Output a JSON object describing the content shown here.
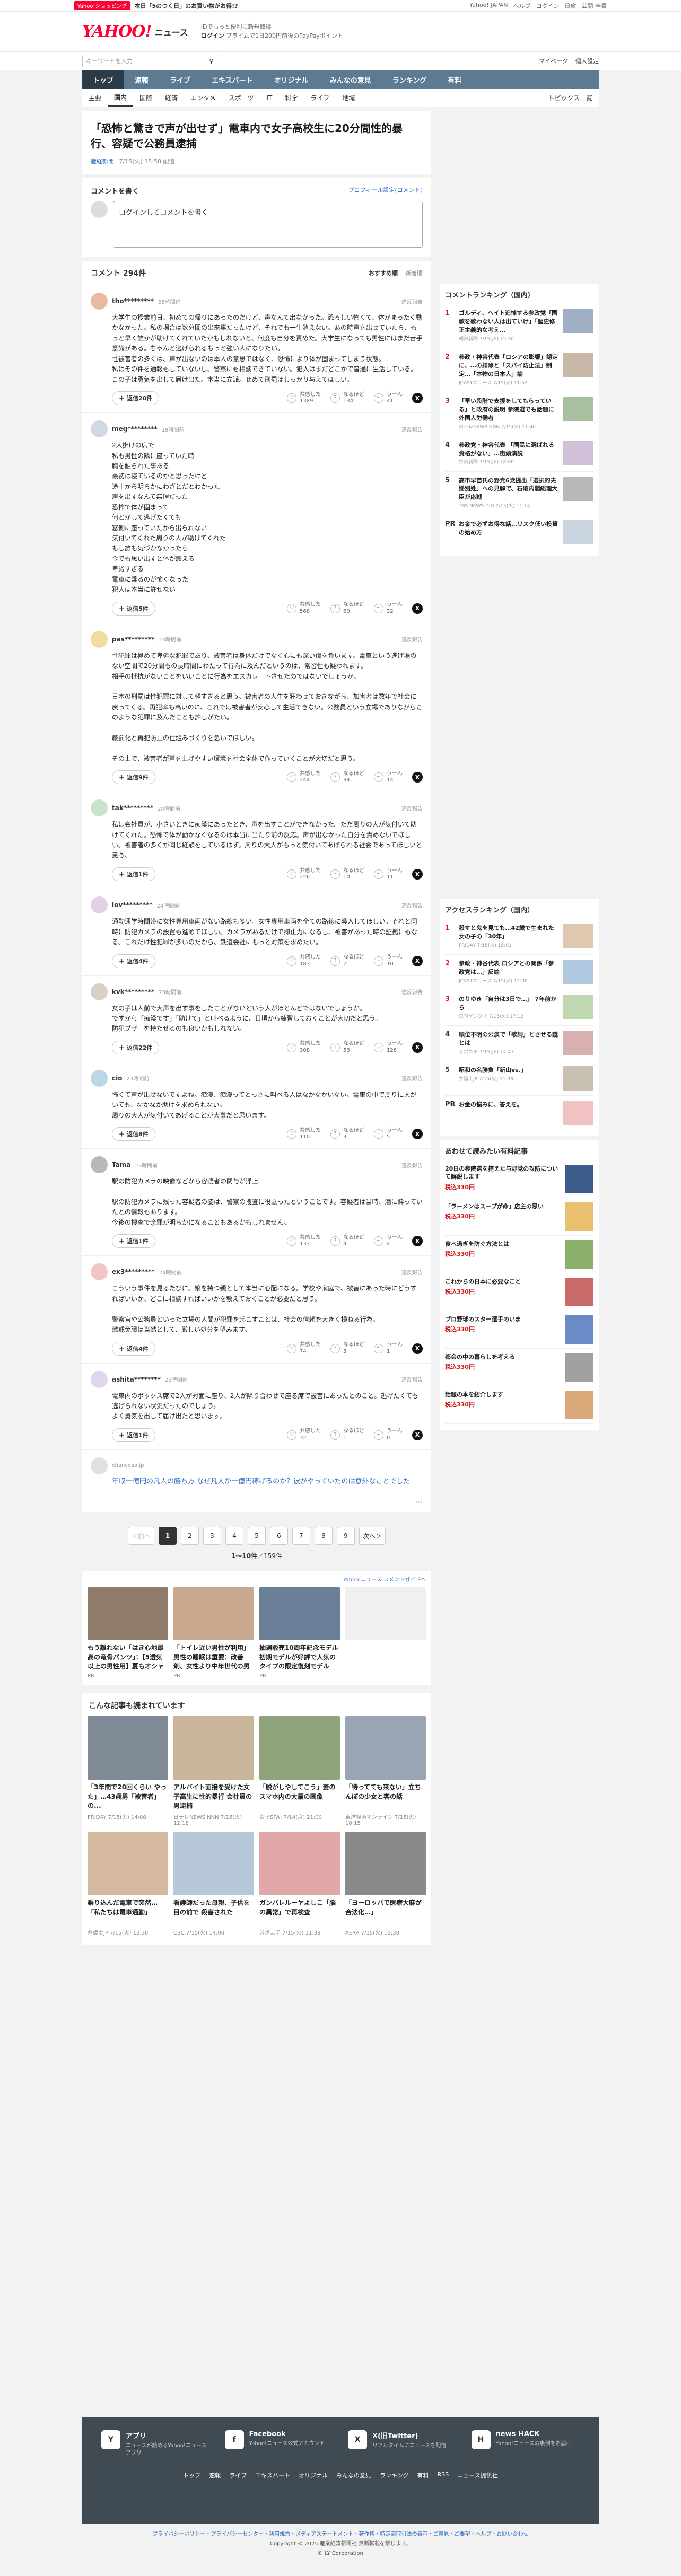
{
  "topbar": {
    "badge": "Yahoo!ショッピング",
    "promo": "本日「5のつく日」のお買い物がお得!?",
    "right": [
      "Yahoo! JAPAN",
      "ヘルプ",
      "ログイン",
      "日傘",
      "公開 全員"
    ]
  },
  "header": {
    "logo": "YAHOO!",
    "logo_sub": "ニュース",
    "tag1": "IDでもっと便利に新規取得",
    "tag2": "ログイン",
    "tag3": "プライムで1日200円前後のPayPayポイント",
    "right1": "ゆるっと",
    "right2": "マイページ"
  },
  "search": {
    "placeholder": "キーワードを入力",
    "right": [
      "マイページ",
      "個人設定"
    ]
  },
  "nav": [
    "トップ",
    "速報",
    "ライブ",
    "エキスパート",
    "オリジナル",
    "みんなの意見",
    "ランキング",
    "有料"
  ],
  "subnav": [
    "主要",
    "国内",
    "国際",
    "経済",
    "エンタメ",
    "スポーツ",
    "IT",
    "科学",
    "ライフ",
    "地域",
    "トピックス一覧"
  ],
  "article": {
    "title": "「恐怖と驚きで声が出せず」電車内で女子高校生に20分間性的暴行、容疑で公務員逮捕",
    "source": "産経新聞",
    "time": "7/15(火) 15:58 配信"
  },
  "comment_write": {
    "title": "コメントを書く",
    "profile_link": "プロフィール設定(コメント)",
    "input": "ログインしてコメントを書く"
  },
  "comment_list": {
    "title": "コメント 294件",
    "sort": [
      "おすすめ順",
      "新着順"
    ]
  },
  "labels": {
    "report": "違反報告",
    "like": "共感した",
    "think": "なるほど",
    "hmm": "うーん",
    "reply_suffix": "返信"
  },
  "comments": [
    {
      "user": "tho*********",
      "time": "25時間前",
      "body": "大学生の授業前日、初めての帰りにあったのだけど、声なんて出なかった。恐ろしい怖くて、体がまったく動かなかった。私の場合は数分間の出来事だったけど、それでも一生消えない。あの時声を出せていたら、もっと早く誰かが助けてくれていたかもしれないと、何度も自分を責めた。大学生になっても男性にはまだ苦手意識がある。ちゃんと逃げられるもっと強い人になりたい。\n性被害者の多くは、声が出ないのは本人の意思ではなく、恐怖により体が固まってしまう状態。\n私はその件を通報もしていないし、警察にも相談できていない。犯人はまだどこかで普通に生活している。この子は勇気を出して届け出た。本当に立派。せめて刑罰はしっかり与えてほしい。",
      "replies": "返信20件",
      "like": "1389",
      "think": "134",
      "hmm": "41"
    },
    {
      "user": "meg*********",
      "time": "19時間前",
      "body": "2人掛けの席で\n私も男性の隣に座っていた時\n胸を触られた事ある\n最初は寝ているのかと思ったけど\n途中から明らかにわざとだとわかった\n声を出すなんて無理だった\n恐怖で体が固まって\n何とかして逃げたくても\n窓側に座っていたから出られない\n気付いてくれた周りの人が助けてくれた\nもし誰も気づかなかったら\n今でも思い出すと体が震える\n卑劣すぎる\n電車に乗るのが怖くなった\n犯人は本当に許せない",
      "replies": "返信5件",
      "like": "568",
      "think": "60",
      "hmm": "32"
    },
    {
      "user": "pas*********",
      "time": "23時間前",
      "body": "性犯罪は極めて卑劣な犯罪であり、被害者は身体だけでなく心にも深い傷を負います。電車という逃げ場のない空間で20分間もの長時間にわたって行為に及んだというのは、常習性も疑われます。\n相手の抵抗がないことをいいことに行為をエスカレートさせたのではないでしょうか。\n\n日本の刑罰は性犯罪に対して軽すぎると思う。被害者の人生を狂わせておきながら、加害者は数年で社会に戻ってくる。再犯率も高いのに、これでは被害者が安心して生活できない。公務員という立場でありながらこのような犯罪に及んだことも許しがたい。\n\n厳罰化と再犯防止の仕組みづくりを急いでほしい。\n\nその上で、被害者が声を上げやすい環境を社会全体で作っていくことが大切だと思う。",
      "replies": "返信9件",
      "like": "244",
      "think": "34",
      "hmm": "14"
    },
    {
      "user": "tak*********",
      "time": "24時間前",
      "body": "私は会社員が、小さいときに痴漢にあったとき、声を出すことができなかった。ただ周りの人が気付いて助けてくれた。恐怖で体が動かなくなるのは本当に当たり前の反応。声が出なかった自分を責めないでほしい。被害者の多くが同じ経験をしているはず。周りの大人がもっと気付いてあげられる社会であってほしいと思う。",
      "replies": "返信1件",
      "like": "226",
      "think": "10",
      "hmm": "11"
    },
    {
      "user": "lov*********",
      "time": "24時間前",
      "body": "通勤通学時間帯に女性専用車両がない路線も多い。女性専用車両を全ての路線に導入してほしい。それと同時に防犯カメラの設置も進めてほしい。カメラがあるだけで抑止力になるし、被害があった時の証拠にもなる。これだけ性犯罪が多いのだから、鉄道会社にもっと対策を求めたい。",
      "replies": "返信4件",
      "like": "183",
      "think": "7",
      "hmm": "10"
    },
    {
      "user": "kvk*********",
      "time": "23時間前",
      "body": "女の子は人前で大声を出す事をしたことがないという人がほとんどではないでしょうか。\nですから「痴漢です」「助けて」と叫べるように、日頃から練習しておくことが大切だと思う。\n防犯ブザーを持たせるのも良いかもしれない。",
      "replies": "返信22件",
      "like": "308",
      "think": "53",
      "hmm": "128"
    },
    {
      "user": "cio",
      "time": "23時間前",
      "body": "怖くて声が出せないですよね。痴漢、痴漢ってとっさに叫べる人はなかなかいない。電車の中で周りに人がいても、なかなか助けを求められない。\n周りの大人が気付いてあげることが大事だと思います。",
      "replies": "返信8件",
      "like": "110",
      "think": "3",
      "hmm": "5"
    },
    {
      "user": "Tama",
      "time": "23時間前",
      "body": "駅の防犯カメラの映像などから容疑者の関与が浮上\n\n駅の防犯カメラに残った容疑者の姿は、警察の捜査に役立ったということです。容疑者は当時、酒に酔っていたとの情報もあります。\n今後の捜査で余罪が明らかになることもあるかもしれません。",
      "replies": "返信1件",
      "like": "133",
      "think": "4",
      "hmm": "4"
    },
    {
      "user": "ex3*********",
      "time": "24時間前",
      "body": "こういう事件を見るたびに、娘を持つ親として本当に心配になる。学校や家庭で、被害にあった時にどうすればいいか、どこに相談すればいいかを教えておくことが必要だと思う。\n\n警察官や公務員といった立場の人間が犯罪を起こすことは、社会の信頼を大きく損ねる行為。\n懲戒免職は当然として、厳しい処分を望みます。",
      "replies": "返信4件",
      "like": "74",
      "think": "3",
      "hmm": "1"
    },
    {
      "user": "ashita********",
      "time": "23時間前",
      "body": "電車内のボックス席で2人が対面に座り、2人が隣り合わせで座る席で被害にあったとのこと。逃げたくても逃げられない状況だったのでしょう。\nよく勇気を出して届け出たと思います。",
      "replies": "返信1件",
      "like": "32",
      "think": "1",
      "hmm": "0"
    }
  ],
  "comment_link": {
    "small": "chanceaa.jp",
    "text": "年収一億円の凡人の勝ち方 なぜ凡人が一億円稼げるのか？彼がやっていたのは意外なことでした"
  },
  "pager": {
    "prev": "＜前へ",
    "pages": [
      "1",
      "2",
      "3",
      "4",
      "5",
      "6",
      "7",
      "8",
      "9"
    ],
    "next": "次へ＞",
    "count_prefix": "1〜10件",
    "count_suffix": "／159件"
  },
  "promo_label": "Yahoo!ニュース コメントガイドへ",
  "promos": [
    {
      "title": "もう離れない「はき心地最高の竜骨パンツ」：【5透気以上の男性用】夏もオシャレなズボンで通勤",
      "meta": "PR"
    },
    {
      "title": "「トイレ近い男性が利用」男性の睡眠は重要：改善剤、女性より中年世代の男性で起こりやすい…",
      "meta": "PR"
    },
    {
      "title": "抽選販売10周年記念モデル 初期モデルが好評で人気のタイプの限定復刻モデル",
      "meta": "PR"
    },
    {
      "title": "",
      "meta": ""
    }
  ],
  "also_read_title": "こんな記事も読まれています",
  "also_read": [
    {
      "title": "「3年間で20回くらい やった」…43歳男「被害者」の...",
      "meta": "FRIDAY 7/15(火) 14:08"
    },
    {
      "title": "アルバイト面接を受けた女子高生に性的暴行 会社員の男逮捕",
      "meta": "日テレNEWS NNN 7/15(火) 12:18"
    },
    {
      "title": "「脱がしやしてこう」妻のスマホ内の大量の画像",
      "meta": "女子SPA! 7/14(月) 21:00"
    },
    {
      "title": "「待ってても来ない」立ちんぼの少女と客の話",
      "meta": "東洋経済オンライン 7/15(火) 18:15"
    },
    {
      "title": "乗り込んだ電車で突然…「私たちは電車通勤」",
      "meta": "弁護士JP 7/15(火) 12:30"
    },
    {
      "title": "看護師だった母親、子供を目の前で 殺害された",
      "meta": "CBC 7/15(火) 14:00"
    },
    {
      "title": "ガンバレルーヤよしこ「脳の異常」で再検査",
      "meta": "スポニチ 7/15(火) 11:38"
    },
    {
      "title": "「ヨーロッパで医療大麻が合法化…」",
      "meta": "AERA 7/15(火) 15:30"
    }
  ],
  "rank1": {
    "title": "コメントランキング（国内）",
    "items": [
      {
        "n": "1",
        "text": "ゴルディ、ヘイト追悼する参政党「国歌を歌わない人は出ていけ」「歴史修正主義的な考え…",
        "src": "朝日新聞 7/15(火) 15:30"
      },
      {
        "n": "2",
        "text": "参政・神谷代表「ロシアの影響」認定に、…の排除と「スパイ防止法」制定…「本物の日本人」論",
        "src": "JCASTニュース 7/15(火) 11:52"
      },
      {
        "n": "3",
        "text": "「早い段階で支援をしてもらっている」と政府の説明 参院選でも話題に外国人労働者",
        "src": "日テレNEWS NNN 7/15(火) 11:46"
      },
      {
        "n": "4",
        "text": "参政党・神谷代表 「国民に選ばれる資格がない」…街頭演説",
        "src": "毎日新聞 7/15(火) 18:00"
      },
      {
        "n": "5",
        "text": "高市早苗氏の野党6党提出「選択的夫婦別姓」への見解で、石破内閣総理大臣が応戦",
        "src": "TBS NEWS DIG 7/15(火) 11:14"
      }
    ],
    "pr": "お金で必ずお得な話…リスク低い投資の始め方"
  },
  "rank2": {
    "title": "アクセスランキング（国内）",
    "items": [
      {
        "n": "1",
        "text": "殺すと鬼を見ても…42歳で生まれた女の子の「30年」",
        "src": "FRIDAY 7/15(火) 15:01"
      },
      {
        "n": "2",
        "text": "参政・神谷代表 ロシアとの関係「参政党は…」反論",
        "src": "JCASTニュース 7/15(火) 12:00"
      },
      {
        "n": "3",
        "text": "のりゆき「自分は3日で…」 7年前から",
        "src": "日刊ゲンダイ 7/15(火) 17:12"
      },
      {
        "n": "4",
        "text": "順位不明の公演で「歌詞」とさせる謎とは",
        "src": "スポニチ 7/15(火) 14:47"
      },
      {
        "n": "5",
        "text": "昭和の名勝負「新山vs.」",
        "src": "弁護士JP 7/15(火) 11:36"
      }
    ],
    "pr": "お金の悩みに、答えを。"
  },
  "books": {
    "title": "あわせて読みたい有料記事",
    "items": [
      {
        "text": "20日の参院選を控えた与野党の攻防について解説します",
        "price": "税込330円"
      },
      {
        "text": "「ラーメンはスープが命」店主の思い",
        "price": "税込330円"
      },
      {
        "text": "食べ過ぎを防ぐ方法とは",
        "price": "税込330円"
      },
      {
        "text": "これからの日本に必要なこと",
        "price": "税込330円"
      },
      {
        "text": "プロ野球のスター選手のいま",
        "price": "税込330円"
      },
      {
        "text": "都会の中の暮らしを考える",
        "price": "税込330円"
      },
      {
        "text": "話題の本を紹介します",
        "price": "税込330円"
      }
    ]
  },
  "footer": {
    "apps": [
      {
        "icon": "Y",
        "title": "アプリ",
        "desc": "ニュースが読めるYahoo!ニュースアプリ"
      },
      {
        "icon": "f",
        "title": "Facebook",
        "desc": "Yahoo!ニュース公式アカウント"
      },
      {
        "icon": "X",
        "title": "X(旧Twitter)",
        "desc": "リアルタイムにニュースを配信"
      },
      {
        "icon": "H",
        "title": "news HACK",
        "desc": "Yahoo!ニュースの裏側をお届け"
      }
    ],
    "links": [
      "トップ",
      "速報",
      "ライブ",
      "エキスパート",
      "オリジナル",
      "みんなの意見",
      "ランキング",
      "有料",
      "RSS",
      "ニュース提供社"
    ]
  },
  "bottom": {
    "links": "プライバシーポリシー・プライバシーセンター・利用規約・メディアステートメント・著作権・特定商取引法の表示・ご意見・ご要望・ヘルプ・お問い合わせ",
    "copyright": "Copyright © 2025 産業経済新聞社 無断転載を禁じます。",
    "corp": "© LY Corporation"
  },
  "colors": {
    "brand": "#ff0033",
    "nav": "#5c7a91",
    "link": "#2b6fc4"
  }
}
